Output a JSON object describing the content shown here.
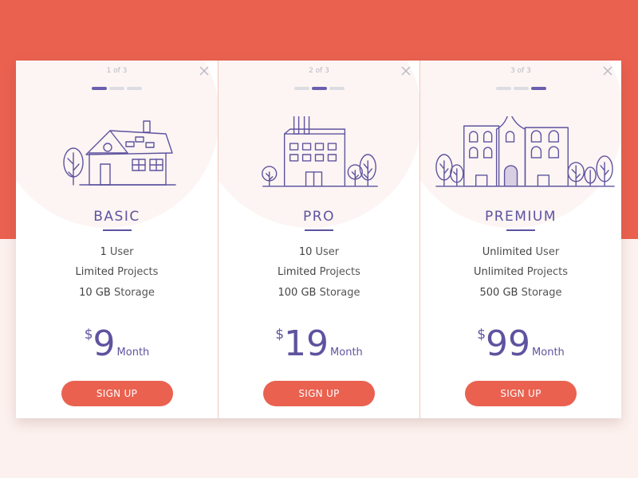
{
  "plans": [
    {
      "pager": "1 of 3",
      "active_dot": 0,
      "name": "BASIC",
      "features": [
        {
          "v": "1",
          "k": "User"
        },
        {
          "v": "Limited",
          "k": "Projects"
        },
        {
          "v": "10 GB",
          "k": "Storage"
        }
      ],
      "currency": "$",
      "amount": "9",
      "period": "Month",
      "cta": "SIGN UP"
    },
    {
      "pager": "2 of 3",
      "active_dot": 1,
      "name": "PRO",
      "features": [
        {
          "v": "10",
          "k": "User"
        },
        {
          "v": "Limited",
          "k": "Projects"
        },
        {
          "v": "100 GB",
          "k": "Storage"
        }
      ],
      "currency": "$",
      "amount": "19",
      "period": "Month",
      "cta": "SIGN UP"
    },
    {
      "pager": "3 of 3",
      "active_dot": 2,
      "name": "PREMIUM",
      "features": [
        {
          "v": "Unlimited",
          "k": "User"
        },
        {
          "v": "Unlimited",
          "k": "Projects"
        },
        {
          "v": "500 GB",
          "k": "Storage"
        }
      ],
      "currency": "$",
      "amount": "99",
      "period": "Month",
      "cta": "SIGN UP"
    }
  ],
  "icons": {
    "close": "close-icon",
    "illustrations": [
      "house-illustration",
      "factory-illustration",
      "mansion-illustration"
    ]
  },
  "colors": {
    "background_top": "#ea6150",
    "background_bottom": "#fcf1ef",
    "accent_purple": "#5e539f",
    "button": "#ea6150",
    "dot_active": "#6a5fae",
    "dot_inactive": "#dcdce2"
  }
}
